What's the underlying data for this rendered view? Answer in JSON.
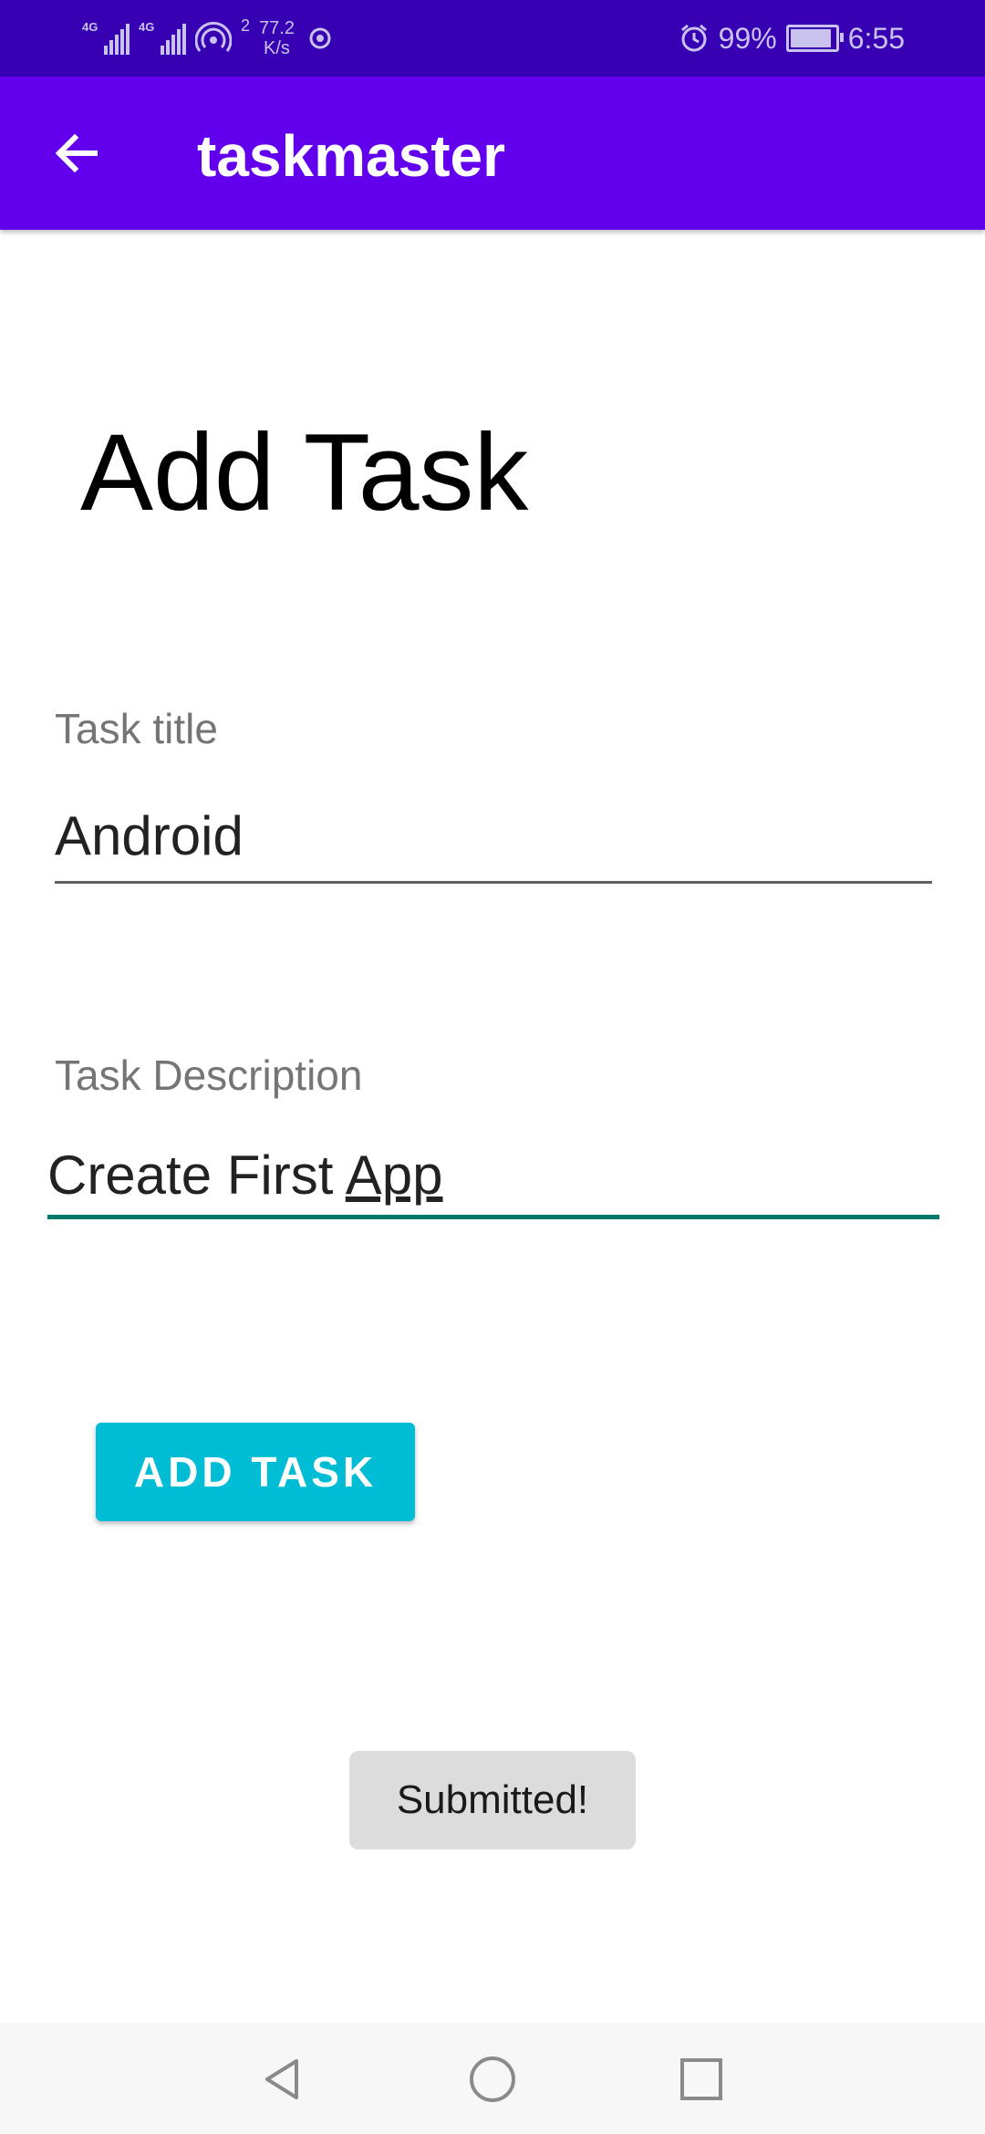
{
  "status_bar": {
    "network_1": "4G",
    "network_2": "4G",
    "hotspot_count": "2",
    "speed_value": "77.2",
    "speed_unit": "K/s",
    "battery": "99%",
    "time": "6:55"
  },
  "app_bar": {
    "title": "taskmaster"
  },
  "page": {
    "heading": "Add Task"
  },
  "form": {
    "title_label": "Task title",
    "title_value": "Android",
    "description_label": "Task Description",
    "description_value_plain": "Create First ",
    "description_value_underlined": "App"
  },
  "actions": {
    "add_task_label": "ADD TASK"
  },
  "toast": {
    "message": "Submitted!"
  },
  "colors": {
    "status_bar": "#3700b3",
    "app_bar": "#6200ee",
    "button": "#00bcd4",
    "active_underline": "#00796b"
  },
  "icons": {
    "back": "arrow-left-icon",
    "nav_back": "triangle-back-icon",
    "nav_home": "circle-home-icon",
    "nav_recents": "square-recents-icon"
  }
}
